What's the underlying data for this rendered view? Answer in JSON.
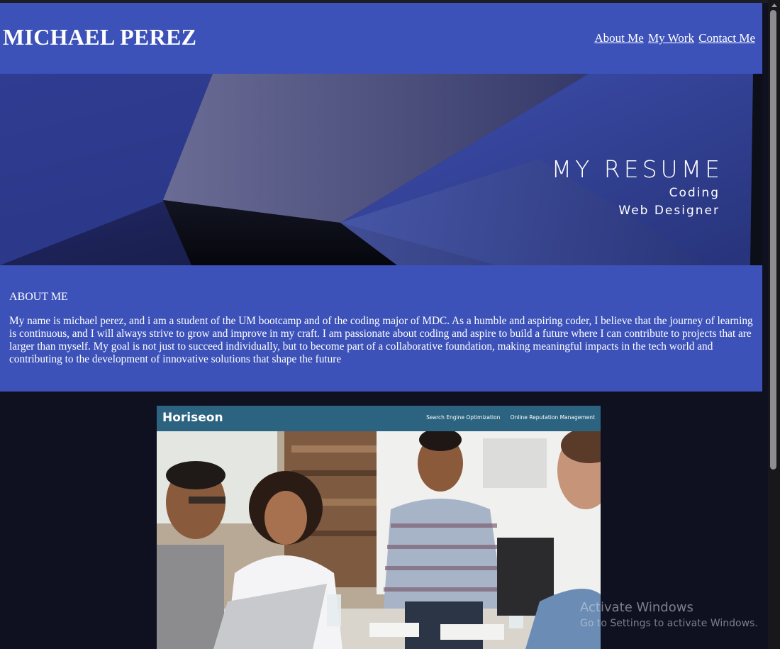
{
  "header": {
    "name": "MICHAEL PEREZ",
    "nav": [
      "About Me",
      "My Work",
      "Contact Me"
    ]
  },
  "hero": {
    "title": "MY RESUME",
    "subtitle_1": "Coding",
    "subtitle_2": "Web Designer"
  },
  "about": {
    "title": "ABOUT ME",
    "text": "My name is michael perez, and i am a student of the UM bootcamp and of the coding major of MDC. As a humble and aspiring coder, I believe that the journey of learning is continuous, and I will always strive to grow and improve in my craft. I am passionate about coding and aspire to build a future where I can contribute to projects that are larger than myself. My goal is not just to succeed individually, but to become part of a collaborative foundation, making meaningful impacts in the tech world and contributing to the development of innovative solutions that shape the future"
  },
  "project": {
    "brand": "Horiseon",
    "links": [
      "Search Engine Optimization",
      "Online Reputation Management"
    ]
  },
  "watermark": {
    "title": "Activate Windows",
    "subtitle": "Go to Settings to activate Windows."
  },
  "colors": {
    "header_bg": "#3c52b9",
    "page_bg": "#0f1120",
    "card_bar": "#2b6380"
  }
}
